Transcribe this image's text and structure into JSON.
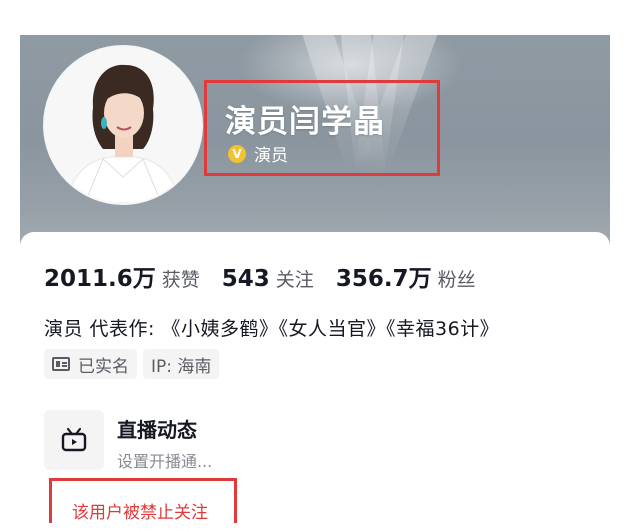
{
  "profile": {
    "display_name": "演员闫学晶",
    "verified_label": "演员",
    "verified_badge": "V"
  },
  "stats": [
    {
      "value": "2011.6万",
      "label": "获赞"
    },
    {
      "value": "543",
      "label": "关注"
    },
    {
      "value": "356.7万",
      "label": "粉丝"
    }
  ],
  "bio": "演员 代表作: 《小姨多鹤》《女人当官》《幸福36计》",
  "tags": {
    "verified_name": "已实名",
    "ip": "IP: 海南"
  },
  "live": {
    "title": "直播动态",
    "subtitle": "设置开播通..."
  },
  "notice": {
    "text": "该用户被禁止关注"
  },
  "colors": {
    "highlight_box": "#e03a3a",
    "verified_badge": "#f2c230"
  },
  "icons": {
    "verified": "verified-v-icon",
    "id_card": "id-card-icon",
    "live_tv": "tv-icon"
  }
}
